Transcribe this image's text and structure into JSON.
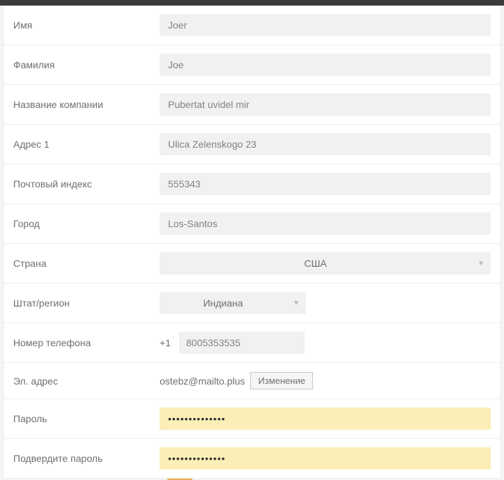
{
  "labels": {
    "first_name": "Имя",
    "last_name": "Фамилия",
    "company": "Название компании",
    "address1": "Адрес 1",
    "zip": "Почтовый индекс",
    "city": "Город",
    "country": "Страна",
    "state": "Штат/регион",
    "phone": "Номер телефона",
    "email": "Эл. адрес",
    "password": "Пароль",
    "password_confirm": "Подвердите пароль"
  },
  "values": {
    "first_name": "Joer",
    "last_name": "Joe",
    "company": "Pubertat uvidel mir",
    "address1": "Ulica Zelenskogo 23",
    "zip": "555343",
    "city": "Los-Santos",
    "country": "США",
    "state": "Индиана",
    "phone_prefix": "+1",
    "phone": "8005353535",
    "email": "ostebz@mailto.plus",
    "password": "••••••••••••••",
    "password_confirm": "••••••••••••••"
  },
  "buttons": {
    "change_email": "Изменение"
  }
}
